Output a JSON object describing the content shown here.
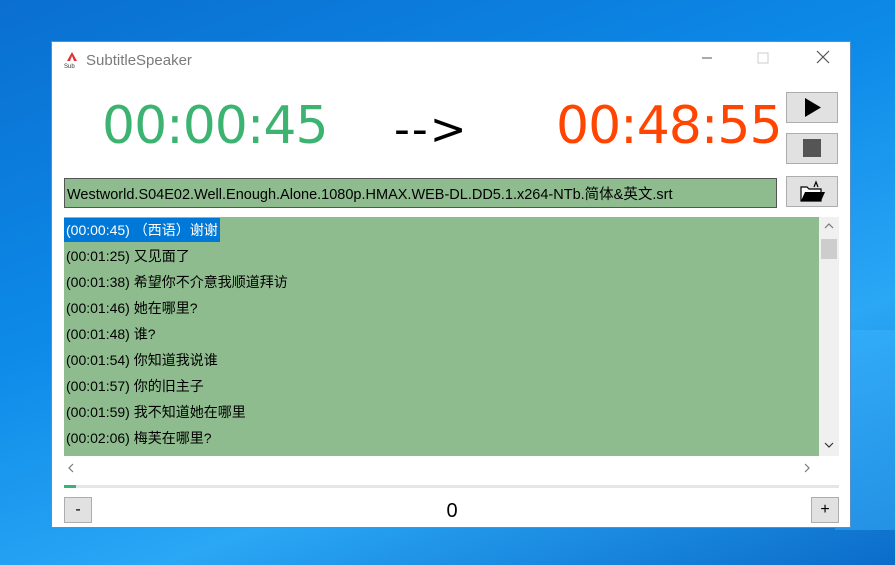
{
  "window": {
    "title": "SubtitleSpeaker",
    "minimize_icon": "minimize-icon",
    "maximize_icon": "maximize-icon",
    "close_icon": "close-icon"
  },
  "timer": {
    "current": "00:00:45",
    "arrow": "-->",
    "total": "00:48:55",
    "current_color": "#3cb371",
    "total_color": "#ff4500"
  },
  "controls": {
    "play_icon": "play-icon",
    "stop_icon": "stop-icon",
    "open_folder_icon": "open-folder-icon"
  },
  "file": {
    "name": "Westworld.S04E02.Well.Enough.Alone.1080p.HMAX.WEB-DL.DD5.1.x264-NTb.简体&英文.srt"
  },
  "subtitles": [
    {
      "text": "(00:00:45) （西语）谢谢",
      "selected": true
    },
    {
      "text": "(00:01:25) 又见面了",
      "selected": false
    },
    {
      "text": "(00:01:38) 希望你不介意我顺道拜访",
      "selected": false
    },
    {
      "text": "(00:01:46) 她在哪里?",
      "selected": false
    },
    {
      "text": "(00:01:48) 谁?",
      "selected": false
    },
    {
      "text": "(00:01:54) 你知道我说谁",
      "selected": false
    },
    {
      "text": "(00:01:57) 你的旧主子",
      "selected": false
    },
    {
      "text": "(00:01:59) 我不知道她在哪里",
      "selected": false
    },
    {
      "text": "(00:02:06) 梅芙在哪里?",
      "selected": false
    }
  ],
  "progress": {
    "fraction": 0.0153
  },
  "offset": {
    "minus_label": "-",
    "value": "0",
    "plus_label": "+"
  },
  "colors": {
    "list_background": "#8fbc8f",
    "selection": "#0078d7"
  }
}
